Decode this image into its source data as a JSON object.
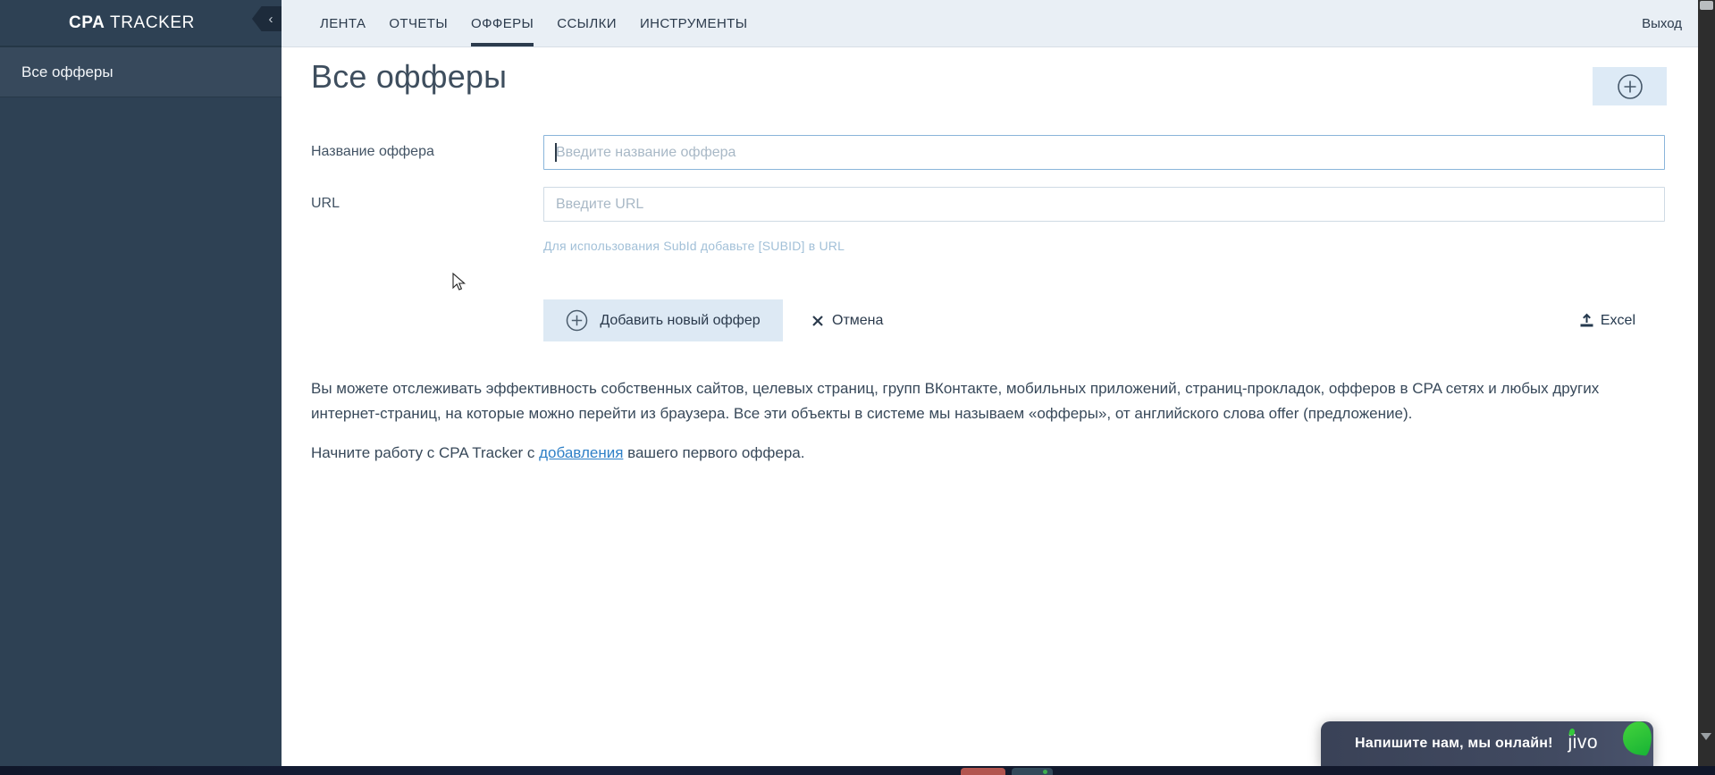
{
  "app": {
    "logo_bold": "CPA",
    "logo_rest": " TRACKER"
  },
  "sidebar": {
    "items": [
      {
        "label": "Все офферы",
        "active": true
      }
    ]
  },
  "topbar": {
    "tabs": [
      {
        "label": "ЛЕНТА",
        "active": false
      },
      {
        "label": "ОТЧЕТЫ",
        "active": false
      },
      {
        "label": "ОФФЕРЫ",
        "active": true
      },
      {
        "label": "ССЫЛКИ",
        "active": false
      },
      {
        "label": "ИНСТРУМЕНТЫ",
        "active": false
      }
    ],
    "logout_label": "Выход"
  },
  "page": {
    "title": "Все офферы"
  },
  "form": {
    "name_label": "Название оффера",
    "name_value": "",
    "name_placeholder": "Введите название оффера",
    "url_label": "URL",
    "url_value": "",
    "url_placeholder": "Введите URL",
    "url_hint": "Для использования SubId добавьте [SUBID] в URL",
    "submit_label": "Добавить новый оффер",
    "cancel_label": "Отмена",
    "excel_label": "Excel"
  },
  "description": {
    "paragraph1": "Вы можете отслеживать эффективность собственных сайтов, целевых страниц, групп ВКонтакте, мобильных приложений, страниц-прокладок, офферов в CPA сетях и любых других интернет-страниц, на которые можно перейти из браузера. Все эти объекты в системе мы называем «офферы», от английского слова offer (предложение).",
    "paragraph2_before": "Начните работу с CPA Tracker с ",
    "paragraph2_link": "добавления",
    "paragraph2_after": " вашего первого оффера."
  },
  "chat": {
    "message": "Напишите нам, мы онлайн!",
    "brand": "jivo"
  },
  "icons": {
    "collapse": "chevron-left",
    "add": "circle-plus",
    "submit": "circle-plus",
    "cancel": "x-mark",
    "excel": "upload-tray",
    "scroll_down": "triangle-down"
  },
  "colors": {
    "sidebar_bg": "#2e4154",
    "sidebar_item_bg": "#37495c",
    "topbar_bg": "#e9eff5",
    "accent_button_bg": "#dde9f4",
    "focused_input_border": "#8ab5da",
    "link": "#2f80c7",
    "hint": "#a2c0d8",
    "jivo_green": "#35c93b",
    "jivo_bg": "#414a61"
  }
}
